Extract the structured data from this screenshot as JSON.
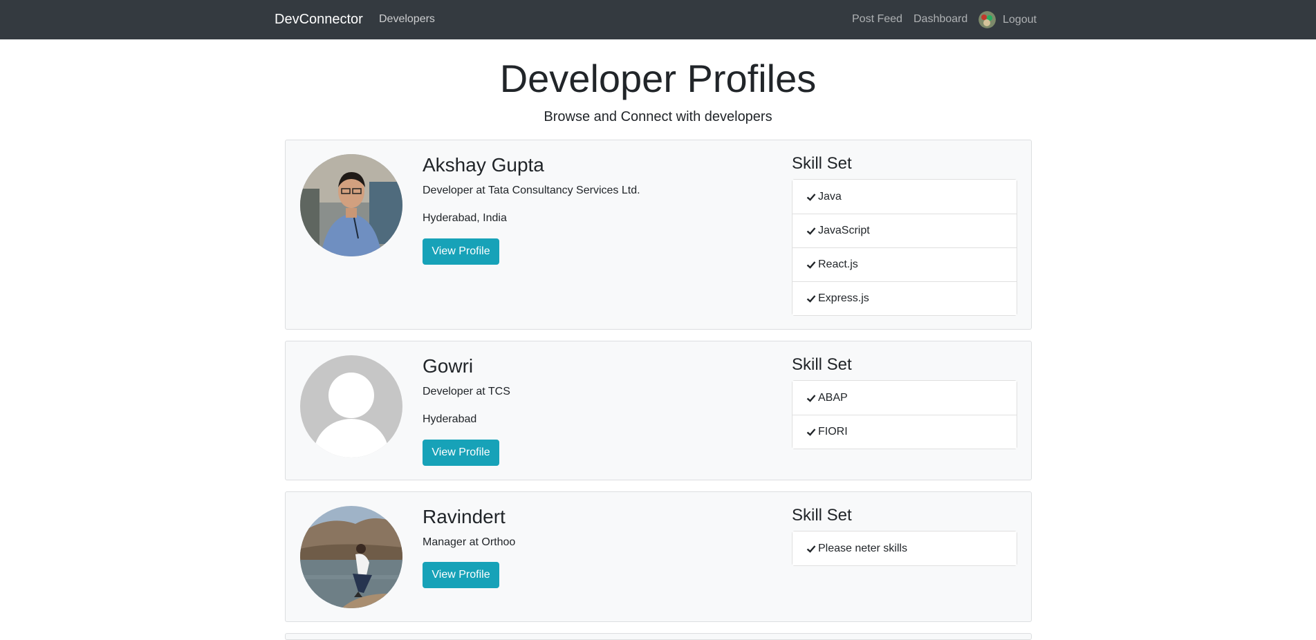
{
  "navbar": {
    "brand": "DevConnector",
    "developers": "Developers",
    "post_feed": "Post Feed",
    "dashboard": "Dashboard",
    "logout": "Logout"
  },
  "header": {
    "title": "Developer Profiles",
    "subtitle": "Browse and Connect with developers"
  },
  "colors": {
    "navbar_bg": "#343a40",
    "button": "#17a2b8",
    "card_bg": "#f8f9fa"
  },
  "profiles": [
    {
      "name": "Akshay Gupta",
      "status": "Developer at Tata Consultancy Services Ltd.",
      "location": "Hyderabad, India",
      "button": "View Profile",
      "skills_heading": "Skill Set",
      "skills": [
        "Java",
        "JavaScript",
        "React.js",
        "Express.js"
      ]
    },
    {
      "name": "Gowri",
      "status": "Developer at TCS",
      "location": "Hyderabad",
      "button": "View Profile",
      "skills_heading": "Skill Set",
      "skills": [
        "ABAP",
        "FIORI"
      ]
    },
    {
      "name": "Ravindert",
      "status": "Manager at Orthoo",
      "location": "",
      "button": "View Profile",
      "skills_heading": "Skill Set",
      "skills": [
        "Please neter skills"
      ]
    }
  ]
}
